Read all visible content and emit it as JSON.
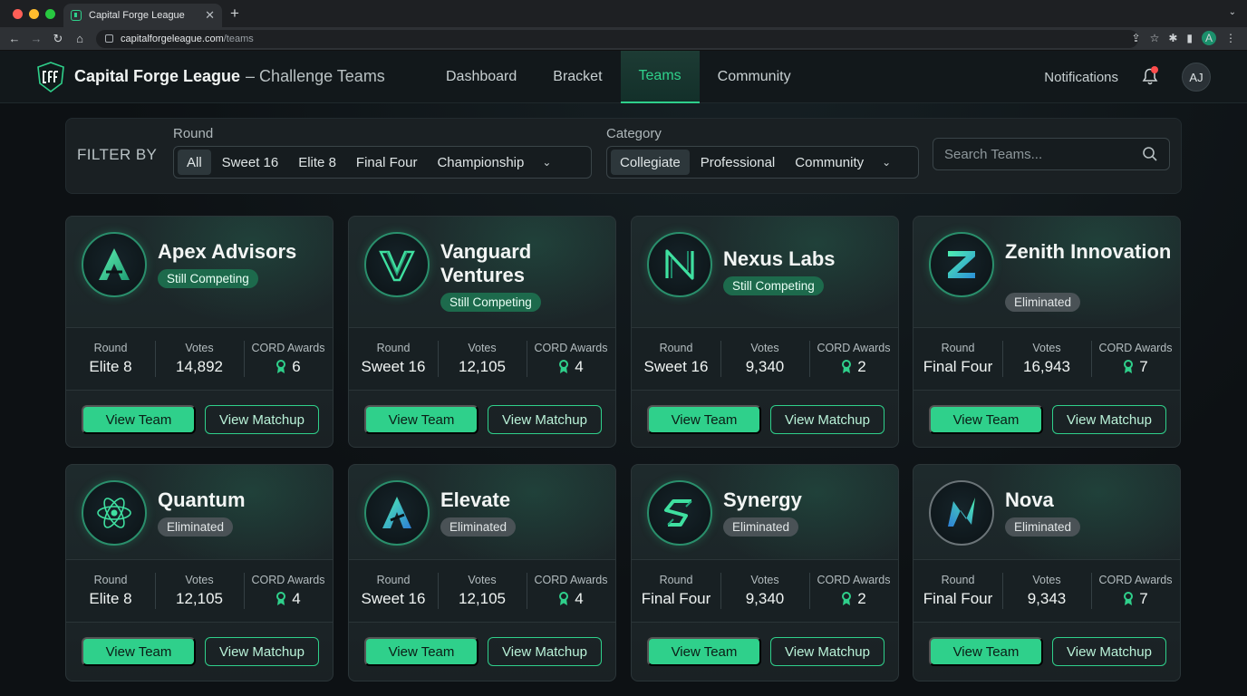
{
  "browser": {
    "tab_title": "Capital Forge League",
    "url_host": "capitalforgeleague.com",
    "url_path": "/teams",
    "profile_initial": "A"
  },
  "header": {
    "title": "Capital Forge League",
    "subtitle": "– Challenge Teams",
    "nav": [
      "Dashboard",
      "Bracket",
      "Teams",
      "Community"
    ],
    "active_nav": "Teams",
    "notifications_label": "Notifications",
    "user_initials": "AJ"
  },
  "filter": {
    "label": "FILTER BY",
    "round_label": "Round",
    "round_options": [
      "All",
      "Sweet 16",
      "Elite 8",
      "Final Four",
      "Championship"
    ],
    "round_selected": "All",
    "category_label": "Category",
    "category_options": [
      "Collegiate",
      "Professional",
      "Community"
    ],
    "category_selected": "Collegiate",
    "search_placeholder": "Search Teams..."
  },
  "stat_labels": {
    "round": "Round",
    "votes": "Votes",
    "awards": "CORD Awards"
  },
  "buttons": {
    "view_team": "View Team",
    "view_matchup": "View Matchup"
  },
  "teams": [
    {
      "name": "Apex Advisors",
      "status": "Still Competing",
      "round": "Elite 8",
      "votes": "14,892",
      "awards": "6",
      "logo": "apex-a-icon"
    },
    {
      "name": "Vanguard Ventures",
      "status": "Still Competing",
      "round": "Sweet 16",
      "votes": "12,105",
      "awards": "4",
      "logo": "vanguard-v-icon"
    },
    {
      "name": "Nexus Labs",
      "status": "Still Competing",
      "round": "Sweet 16",
      "votes": "9,340",
      "awards": "2",
      "logo": "nexus-n-icon"
    },
    {
      "name": "Zenith Innovation",
      "status": "Eliminated",
      "round": "Final Four",
      "votes": "16,943",
      "awards": "7",
      "logo": "zenith-z-icon"
    },
    {
      "name": "Quantum",
      "status": "Eliminated",
      "round": "Elite 8",
      "votes": "12,105",
      "awards": "4",
      "logo": "atom-icon"
    },
    {
      "name": "Elevate",
      "status": "Eliminated",
      "round": "Sweet 16",
      "votes": "12,105",
      "awards": "4",
      "logo": "elevate-a-icon"
    },
    {
      "name": "Synergy",
      "status": "Eliminated",
      "round": "Final Four",
      "votes": "9,340",
      "awards": "2",
      "logo": "synergy-s-icon"
    },
    {
      "name": "Nova",
      "status": "Eliminated",
      "round": "Final Four",
      "votes": "9,343",
      "awards": "7",
      "logo": "nova-n-icon"
    }
  ],
  "colors": {
    "accent": "#2fd08b",
    "background": "#0f1315",
    "card": "#1e2a2c",
    "eliminated": "#4a5256",
    "competing": "#1d6a4c"
  }
}
